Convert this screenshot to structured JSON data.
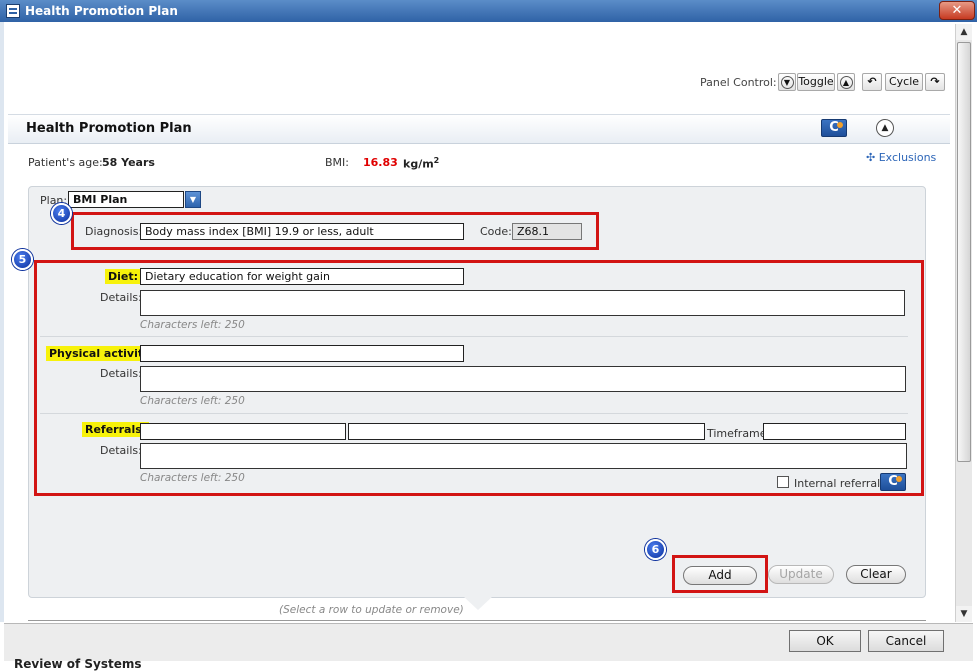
{
  "window": {
    "title": "Health Promotion Plan",
    "close_glyph": "✕"
  },
  "panel_control": {
    "label": "Panel Control:",
    "toggle_label": "Toggle",
    "cycle_label": "Cycle"
  },
  "header": {
    "title": "Health Promotion Plan"
  },
  "patient": {
    "age_label": "Patient's age:",
    "age_value": "58 Years",
    "bmi_label": "BMI:",
    "bmi_value": "16.83",
    "bmi_unit": "kg/m",
    "bmi_unit_sup": "2",
    "bmi_color": "#e00000",
    "exclusions_label": "Exclusions"
  },
  "plan": {
    "label": "Plan:",
    "selected": "BMI Plan",
    "diagnosis_label": "Diagnosis:",
    "diagnosis_value": "Body mass index [BMI] 19.9 or less, adult",
    "code_label": "Code:",
    "code_value": "Z68.1"
  },
  "diet": {
    "label": "Diet:",
    "value": "Dietary education for weight gain",
    "details_label": "Details:",
    "chars_left": "Characters left: 250"
  },
  "physical_activity": {
    "label": "Physical activity:",
    "value": "",
    "details_label": "Details:",
    "chars_left": "Characters left: 250"
  },
  "referrals": {
    "label": "Referrals:",
    "timeframe_label": "Timeframe:",
    "details_label": "Details:",
    "chars_left": "Characters left: 250",
    "internal_referral_label": "Internal referral"
  },
  "actions": {
    "add_label": "Add",
    "update_label": "Update",
    "clear_label": "Clear",
    "table_hint": "(Select a row to update or remove)"
  },
  "callouts": {
    "step4": "4",
    "step5": "5",
    "step6": "6",
    "color": "#d21414"
  },
  "dialog": {
    "ok_label": "OK",
    "cancel_label": "Cancel"
  },
  "below_section": {
    "label": "Review of Systems"
  }
}
